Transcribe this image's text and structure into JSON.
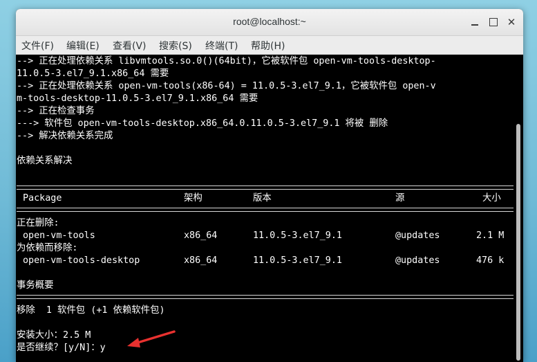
{
  "window": {
    "title": "root@localhost:~"
  },
  "menu": [
    "文件(F)",
    "编辑(E)",
    "查看(V)",
    "搜索(S)",
    "终端(T)",
    "帮助(H)"
  ],
  "terminal": {
    "lines_top": [
      "--> 正在处理依赖关系 libvmtools.so.0()(64bit)，它被软件包 open-vm-tools-desktop-",
      "11.0.5-3.el7_9.1.x86_64 需要",
      "--> 正在处理依赖关系 open-vm-tools(x86-64) = 11.0.5-3.el7_9.1，它被软件包 open-v",
      "m-tools-desktop-11.0.5-3.el7_9.1.x86_64 需要",
      "--> 正在检查事务",
      "---> 软件包 open-vm-tools-desktop.x86_64.0.11.0.5-3.el7_9.1 将被 删除",
      "--> 解决依赖关系完成",
      "",
      "依赖关系解决"
    ],
    "table": {
      "headers": {
        "package": "Package",
        "arch": "架构",
        "version": "版本",
        "repo": "源",
        "size": "大小"
      },
      "section_remove": "正在删除:",
      "section_dep": "为依赖而移除:",
      "rows": [
        {
          "package": "open-vm-tools",
          "arch": "x86_64",
          "version": "11.0.5-3.el7_9.1",
          "repo": "@updates",
          "size": "2.1 M"
        },
        {
          "package": "open-vm-tools-desktop",
          "arch": "x86_64",
          "version": "11.0.5-3.el7_9.1",
          "repo": "@updates",
          "size": "476 k"
        }
      ]
    },
    "summary_title": "事务概要",
    "summary_line": "移除  1 软件包 (+1 依赖软件包)",
    "install_size": "安装大小：2.5 M",
    "prompt": "是否继续？[y/N]：y"
  },
  "colors": {
    "terminal_bg": "#000000",
    "terminal_fg": "#ffffff",
    "arrow": "#e8312f"
  }
}
